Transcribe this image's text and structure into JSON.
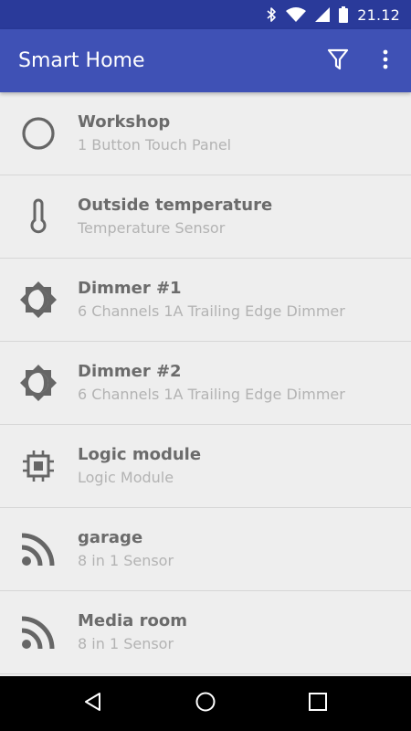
{
  "status_bar": {
    "time": "21.12",
    "icons": [
      "bluetooth-icon",
      "wifi-icon",
      "signal-icon",
      "battery-icon"
    ]
  },
  "app_bar": {
    "title": "Smart Home",
    "actions": [
      "filter-icon",
      "overflow-menu-icon"
    ]
  },
  "devices": [
    {
      "name": "Workshop",
      "type": "1 Button Touch Panel",
      "icon": "circle-outline-icon"
    },
    {
      "name": "Outside temperature",
      "type": "Temperature Sensor",
      "icon": "thermometer-icon"
    },
    {
      "name": "Dimmer #1",
      "type": "6 Channels 1A Trailing Edge Dimmer",
      "icon": "brightness-icon"
    },
    {
      "name": "Dimmer #2",
      "type": "6 Channels 1A Trailing Edge Dimmer",
      "icon": "brightness-icon"
    },
    {
      "name": "Logic module",
      "type": "Logic Module",
      "icon": "chip-icon"
    },
    {
      "name": "garage",
      "type": "8 in 1 Sensor",
      "icon": "rss-icon"
    },
    {
      "name": "Media room",
      "type": "8 in 1 Sensor",
      "icon": "rss-icon"
    }
  ],
  "nav_bar": {
    "buttons": [
      "back-icon",
      "home-icon",
      "recents-icon"
    ]
  },
  "colors": {
    "status_bar": "#2a3a9a",
    "app_bar": "#3f51b5",
    "background": "#eeeeee",
    "item_title": "#6b6b6b",
    "item_subtitle": "#b3b3b3",
    "icon": "#666666"
  }
}
